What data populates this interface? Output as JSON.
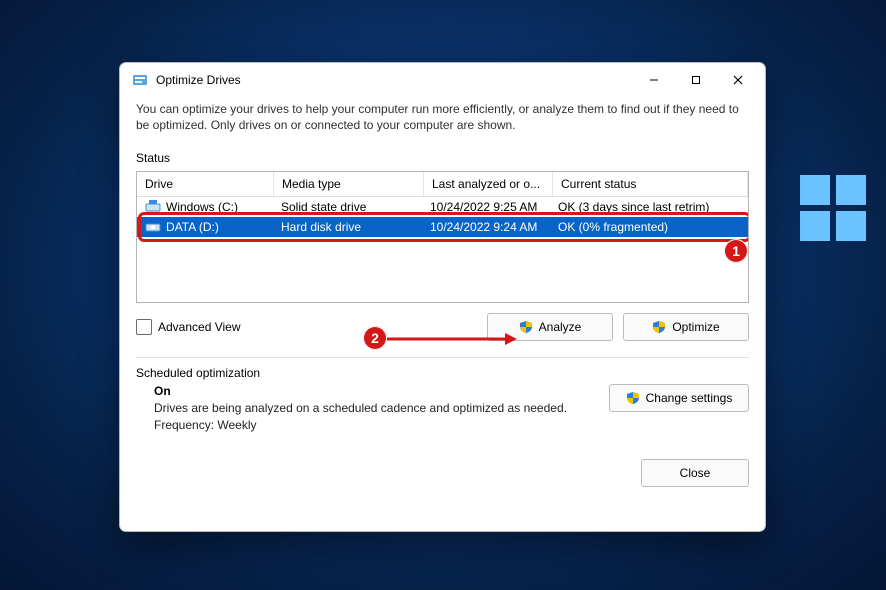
{
  "window": {
    "title": "Optimize Drives",
    "intro": "You can optimize your drives to help your computer run more efficiently, or analyze them to find out if they need to be optimized. Only drives on or connected to your computer are shown."
  },
  "status": {
    "label": "Status",
    "columns": {
      "drive": "Drive",
      "media": "Media type",
      "last": "Last analyzed or o...",
      "status": "Current status"
    },
    "rows": [
      {
        "name": "Windows (C:)",
        "media": "Solid state drive",
        "last": "10/24/2022 9:25 AM",
        "status": "OK (3 days since last retrim)",
        "selected": false
      },
      {
        "name": "DATA (D:)",
        "media": "Hard disk drive",
        "last": "10/24/2022 9:24 AM",
        "status": "OK (0% fragmented)",
        "selected": true
      }
    ]
  },
  "advanced_view_label": "Advanced View",
  "buttons": {
    "analyze": "Analyze",
    "optimize": "Optimize",
    "change_settings": "Change settings",
    "close": "Close"
  },
  "scheduled": {
    "header": "Scheduled optimization",
    "state": "On",
    "desc": "Drives are being analyzed on a scheduled cadence and optimized as needed.",
    "freq": "Frequency: Weekly"
  },
  "annotations": {
    "badge1": "1",
    "badge2": "2"
  }
}
